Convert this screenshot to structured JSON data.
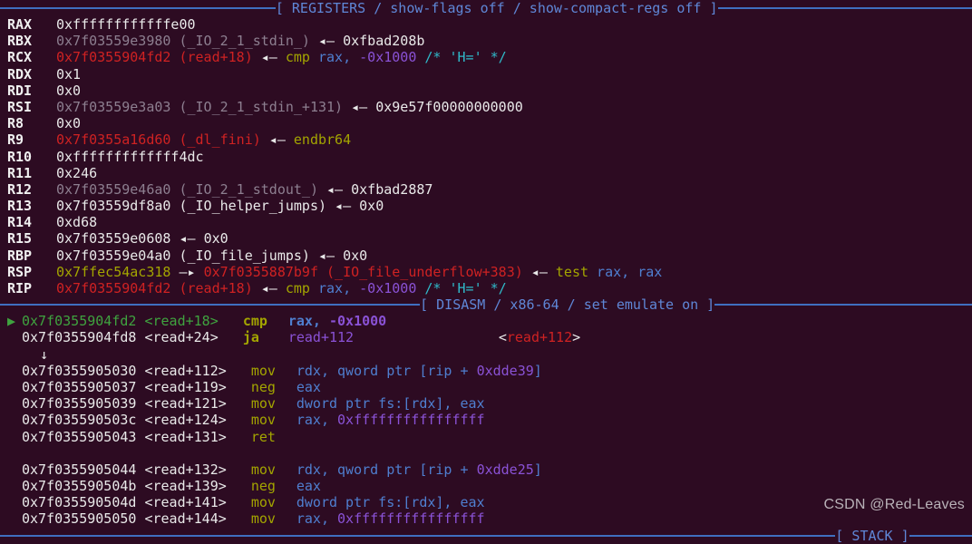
{
  "theme": {
    "background": "#2d0b22",
    "rule_color": "#3f6fc0",
    "banner_text_color": "#5f87d7",
    "default_text": "#e9e9e9",
    "symbol_gray": "#8d7f90",
    "code_red": "#cf2222",
    "mnemonic_olive": "#a3a500",
    "register_blue": "#4f7fd0",
    "immediate_purple": "#8a52d6",
    "comment_cyan": "#2fb9c9",
    "marker_green": "#3fa33f",
    "stack_olive": "#a3a500"
  },
  "banners": {
    "registers": "[ REGISTERS / show-flags off / show-compact-regs off ]",
    "disasm": "[ DISASM / x86-64 / set emulate on ]",
    "stack": "[ STACK ]"
  },
  "registers": [
    {
      "name": "RAX",
      "value": "0xffffffffffffe00",
      "value_color": "white",
      "symbol": "",
      "arrow": "",
      "deref": "",
      "deref_color": "",
      "tail": ""
    },
    {
      "name": "RBX",
      "value": "0x7f03559e3980",
      "value_color": "gray",
      "symbol": "(_IO_2_1_stdin_)",
      "arrow": "◂—",
      "deref": "0xfbad208b",
      "deref_color": "white",
      "tail": ""
    },
    {
      "name": "RCX",
      "value": "0x7f0355904fd2",
      "value_color": "red",
      "symbol": "(read+18)",
      "arrow": "◂—",
      "deref": "cmp",
      "deref_color": "olive",
      "tail": " rax, -0x1000 /* 'H=' */",
      "tail_parts": [
        {
          "text": " rax,",
          "color": "blue"
        },
        {
          "text": " -0x1000",
          "color": "purple"
        },
        {
          "text": " /* 'H=' */",
          "color": "cyan"
        }
      ]
    },
    {
      "name": "RDX",
      "value": "0x1",
      "value_color": "white",
      "symbol": "",
      "arrow": "",
      "deref": "",
      "deref_color": "",
      "tail": ""
    },
    {
      "name": "RDI",
      "value": "0x0",
      "value_color": "white",
      "symbol": "",
      "arrow": "",
      "deref": "",
      "deref_color": "",
      "tail": ""
    },
    {
      "name": "RSI",
      "value": "0x7f03559e3a03",
      "value_color": "gray",
      "symbol": "(_IO_2_1_stdin_+131)",
      "arrow": "◂—",
      "deref": "0x9e57f00000000000",
      "deref_color": "white",
      "tail": ""
    },
    {
      "name": "R8",
      "value": "0x0",
      "value_color": "white",
      "symbol": "",
      "arrow": "",
      "deref": "",
      "deref_color": "",
      "tail": ""
    },
    {
      "name": "R9",
      "value": "0x7f0355a16d60",
      "value_color": "red",
      "symbol": "(_dl_fini)",
      "arrow": "◂—",
      "deref": "endbr64",
      "deref_color": "olive",
      "tail": ""
    },
    {
      "name": "R10",
      "value": "0xfffffffffffff4dc",
      "value_color": "white",
      "symbol": "",
      "arrow": "",
      "deref": "",
      "deref_color": "",
      "tail": ""
    },
    {
      "name": "R11",
      "value": "0x246",
      "value_color": "white",
      "symbol": "",
      "arrow": "",
      "deref": "",
      "deref_color": "",
      "tail": ""
    },
    {
      "name": "R12",
      "value": "0x7f03559e46a0",
      "value_color": "gray",
      "symbol": "(_IO_2_1_stdout_)",
      "arrow": "◂—",
      "deref": "0xfbad2887",
      "deref_color": "white",
      "tail": ""
    },
    {
      "name": "R13",
      "value": "0x7f03559df8a0",
      "value_color": "white",
      "symbol": "(_IO_helper_jumps)",
      "arrow": "◂—",
      "deref": "0x0",
      "deref_color": "white",
      "tail": ""
    },
    {
      "name": "R14",
      "value": "0xd68",
      "value_color": "white",
      "symbol": "",
      "arrow": "",
      "deref": "",
      "deref_color": "",
      "tail": ""
    },
    {
      "name": "R15",
      "value": "0x7f03559e0608",
      "value_color": "white",
      "symbol": "",
      "arrow": "◂—",
      "deref": "0x0",
      "deref_color": "white",
      "tail": ""
    },
    {
      "name": "RBP",
      "value": "0x7f03559e04a0",
      "value_color": "white",
      "symbol": "(_IO_file_jumps)",
      "arrow": "◂—",
      "deref": "0x0",
      "deref_color": "white",
      "tail": ""
    },
    {
      "name": "RSP",
      "value": "0x7ffec54ac318",
      "value_color": "olive",
      "symbol": "",
      "arrow": "—▸",
      "deref": "0x7f0355887b9f",
      "deref_color": "red",
      "symbol2": "(_IO_file_underflow+383)",
      "arrow2": "◂—",
      "tail": "test rax, rax",
      "tail_parts": [
        {
          "text": "test",
          "color": "olive"
        },
        {
          "text": " rax, rax",
          "color": "blue"
        }
      ]
    },
    {
      "name": "RIP",
      "value": "0x7f0355904fd2",
      "value_color": "red",
      "symbol": "(read+18)",
      "arrow": "◂—",
      "deref": "cmp",
      "deref_color": "olive",
      "tail": " rax, -0x1000 /* 'H=' */",
      "tail_parts": [
        {
          "text": " rax,",
          "color": "blue"
        },
        {
          "text": " -0x1000",
          "color": "purple"
        },
        {
          "text": " /* 'H=' */",
          "color": "cyan"
        }
      ]
    }
  ],
  "disasm": [
    {
      "kind": "instr",
      "marker": "▶",
      "current": true,
      "addr": "0x7f0355904fd2",
      "sym": "<read+18>",
      "mnemonic": "cmp",
      "mnemonic_bold": true,
      "ops_parts": [
        {
          "text": "rax, ",
          "color": "blue",
          "bold": true
        },
        {
          "text": "-0x1000",
          "color": "purple",
          "bold": true
        }
      ],
      "annotation": "",
      "annotation_sym": ""
    },
    {
      "kind": "instr",
      "marker": "",
      "current": false,
      "addr": "0x7f0355904fd8",
      "sym": "<read+24>",
      "mnemonic": "ja",
      "mnemonic_bold": true,
      "ops_parts": [
        {
          "text": "read+112",
          "color": "purple",
          "bold": false
        }
      ],
      "annotation": "<read+112>",
      "annotation_sym": "read+112"
    },
    {
      "kind": "branch-arrow",
      "glyph": "↓"
    },
    {
      "kind": "instr",
      "marker": "",
      "current": false,
      "addr": "0x7f0355905030",
      "sym": "<read+112>",
      "mnemonic": "mov",
      "mnemonic_bold": false,
      "ops_parts": [
        {
          "text": "rdx, qword ptr [rip + ",
          "color": "blue",
          "bold": false
        },
        {
          "text": "0xdde39",
          "color": "purple",
          "bold": false
        },
        {
          "text": "]",
          "color": "blue",
          "bold": false
        }
      ],
      "annotation": "",
      "annotation_sym": ""
    },
    {
      "kind": "instr",
      "marker": "",
      "current": false,
      "addr": "0x7f0355905037",
      "sym": "<read+119>",
      "mnemonic": "neg",
      "mnemonic_bold": false,
      "ops_parts": [
        {
          "text": "eax",
          "color": "blue",
          "bold": false
        }
      ],
      "annotation": "",
      "annotation_sym": ""
    },
    {
      "kind": "instr",
      "marker": "",
      "current": false,
      "addr": "0x7f0355905039",
      "sym": "<read+121>",
      "mnemonic": "mov",
      "mnemonic_bold": false,
      "ops_parts": [
        {
          "text": "dword ptr fs:[rdx], eax",
          "color": "blue",
          "bold": false
        }
      ],
      "annotation": "",
      "annotation_sym": ""
    },
    {
      "kind": "instr",
      "marker": "",
      "current": false,
      "addr": "0x7f035590503c",
      "sym": "<read+124>",
      "mnemonic": "mov",
      "mnemonic_bold": false,
      "ops_parts": [
        {
          "text": "rax, ",
          "color": "blue",
          "bold": false
        },
        {
          "text": "0xffffffffffffffff",
          "color": "purple",
          "bold": false
        }
      ],
      "annotation": "",
      "annotation_sym": ""
    },
    {
      "kind": "instr",
      "marker": "",
      "current": false,
      "addr": "0x7f0355905043",
      "sym": "<read+131>",
      "mnemonic": "ret",
      "mnemonic_bold": false,
      "ops_parts": [],
      "annotation": "",
      "annotation_sym": ""
    },
    {
      "kind": "gap"
    },
    {
      "kind": "instr",
      "marker": "",
      "current": false,
      "addr": "0x7f0355905044",
      "sym": "<read+132>",
      "mnemonic": "mov",
      "mnemonic_bold": false,
      "ops_parts": [
        {
          "text": "rdx, qword ptr [rip + ",
          "color": "blue",
          "bold": false
        },
        {
          "text": "0xdde25",
          "color": "purple",
          "bold": false
        },
        {
          "text": "]",
          "color": "blue",
          "bold": false
        }
      ],
      "annotation": "",
      "annotation_sym": ""
    },
    {
      "kind": "instr",
      "marker": "",
      "current": false,
      "addr": "0x7f035590504b",
      "sym": "<read+139>",
      "mnemonic": "neg",
      "mnemonic_bold": false,
      "ops_parts": [
        {
          "text": "eax",
          "color": "blue",
          "bold": false
        }
      ],
      "annotation": "",
      "annotation_sym": ""
    },
    {
      "kind": "instr",
      "marker": "",
      "current": false,
      "addr": "0x7f035590504d",
      "sym": "<read+141>",
      "mnemonic": "mov",
      "mnemonic_bold": false,
      "ops_parts": [
        {
          "text": "dword ptr fs:[rdx], eax",
          "color": "blue",
          "bold": false
        }
      ],
      "annotation": "",
      "annotation_sym": ""
    },
    {
      "kind": "instr",
      "marker": "",
      "current": false,
      "addr": "0x7f0355905050",
      "sym": "<read+144>",
      "mnemonic": "mov",
      "mnemonic_bold": false,
      "ops_parts": [
        {
          "text": "rax, ",
          "color": "blue",
          "bold": false
        },
        {
          "text": "0xffffffffffffffff",
          "color": "purple",
          "bold": false
        }
      ],
      "annotation": "",
      "annotation_sym": ""
    }
  ],
  "watermark": "CSDN @Red-Leaves"
}
